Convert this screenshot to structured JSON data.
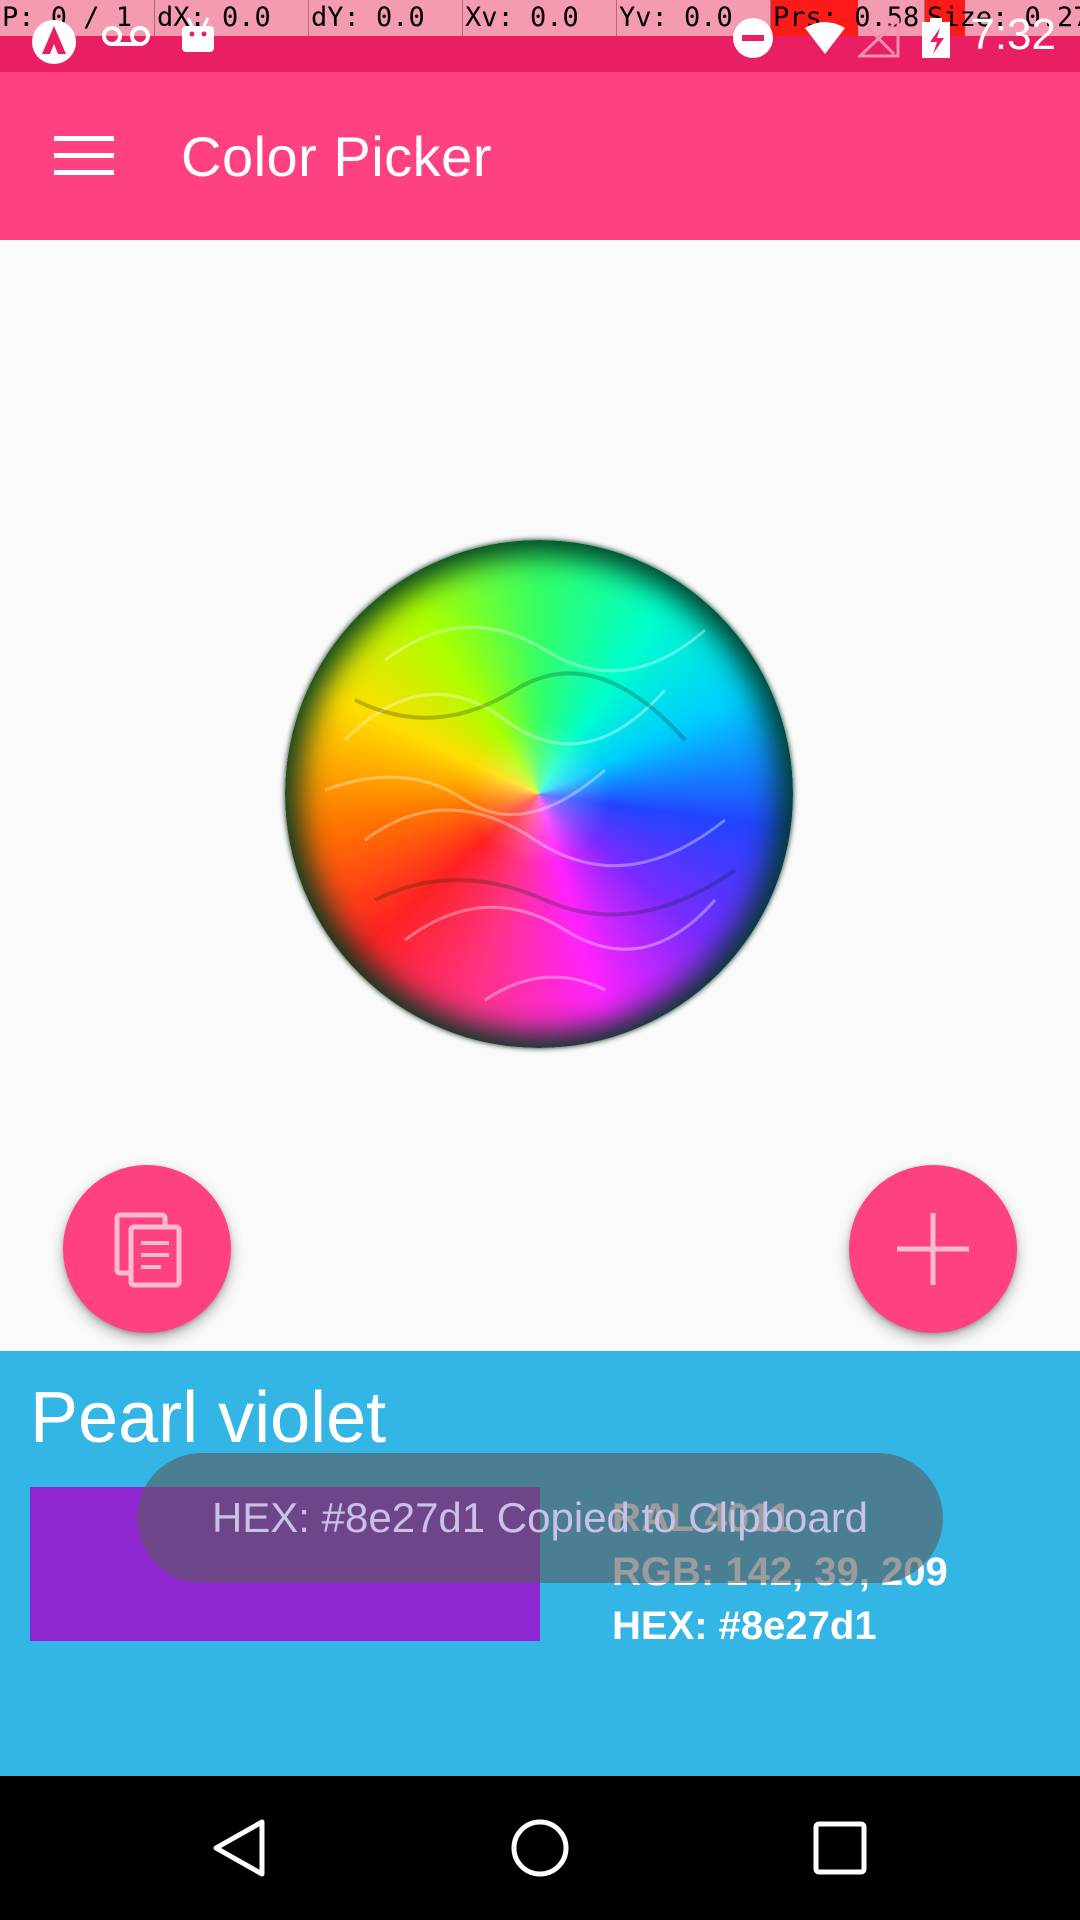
{
  "debug_overlay": {
    "pointer": "P: 0 / 1",
    "dx": "dX: 0.0",
    "dy": "dY: 0.0",
    "xv": "Xv: 0.0",
    "yv": "Yv: 0.0",
    "prs": "Prs: 0.58",
    "size": "Size: 0.27"
  },
  "status_bar": {
    "time": "7:32",
    "icons": [
      "app-notification-icon",
      "voicemail-icon",
      "android-icon",
      "do-not-disturb-icon",
      "wifi-icon",
      "no-signal-icon",
      "battery-icon"
    ]
  },
  "app_bar": {
    "title": "Color Picker",
    "menu_icon": "hamburger-menu-icon"
  },
  "buttons": {
    "copy_icon": "copy-icon",
    "add_icon": "plus-icon"
  },
  "color_info": {
    "name": "Pearl violet",
    "swatch_color": "#8e27d1",
    "ral": "RAL 4011",
    "rgb": "RGB: 142, 39, 209",
    "hex": "HEX: #8e27d1"
  },
  "toast": {
    "message": "HEX: #8e27d1 Copied to Clipboard"
  },
  "colors": {
    "status_bar": "#e91e63",
    "primary": "#ff4081",
    "panel": "#33b5e5"
  },
  "nav_bar": {
    "icons": [
      "back-icon",
      "home-icon",
      "recents-icon"
    ]
  }
}
